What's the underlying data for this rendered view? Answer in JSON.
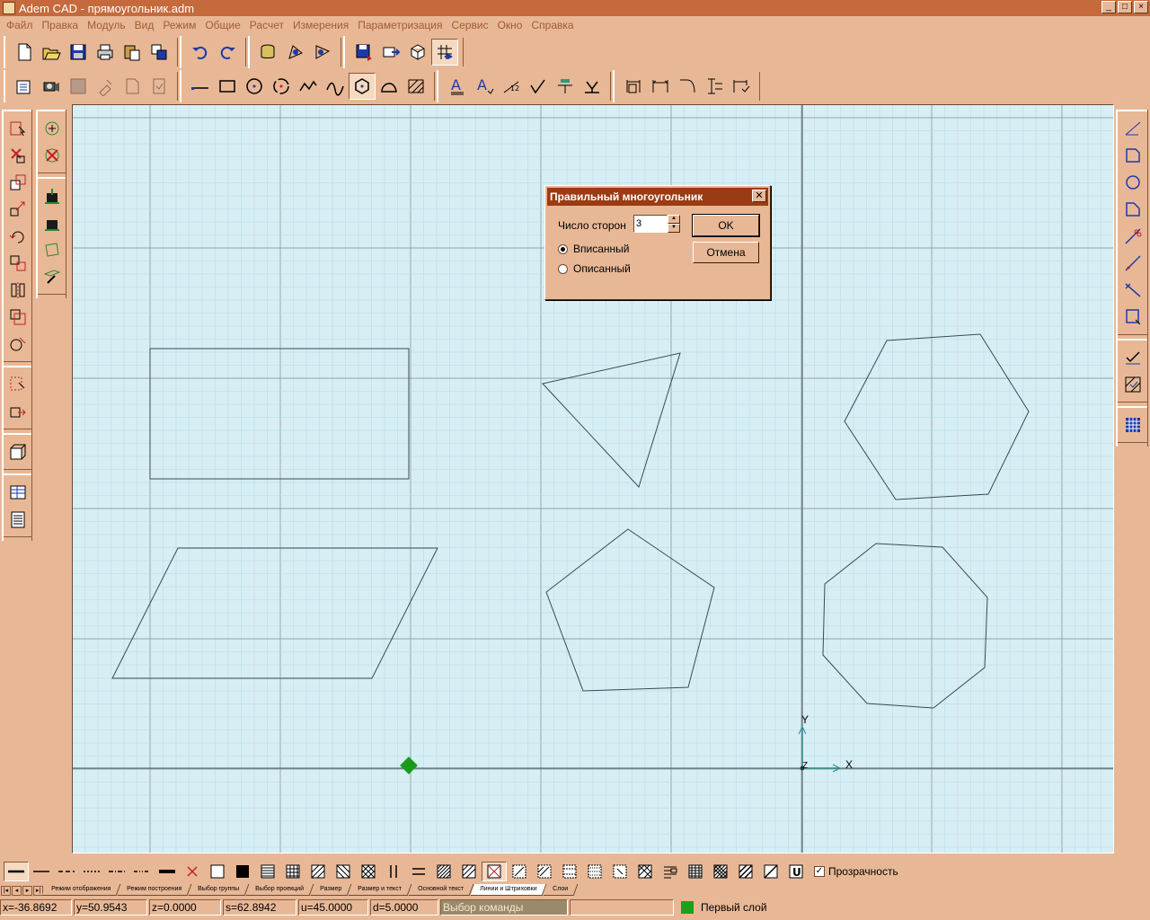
{
  "window": {
    "title": "Adem CAD - прямоугольник.adm",
    "min": "_",
    "max": "□",
    "close": "×"
  },
  "menu": [
    "Файл",
    "Правка",
    "Модуль",
    "Вид",
    "Режим",
    "Общие",
    "Расчет",
    "Измерения",
    "Параметризация",
    "Сервис",
    "Окно",
    "Справка"
  ],
  "colors": {
    "accent": "#c56a3c",
    "canvas_bg": "#d7eef5",
    "grid_major": "#7a8c94",
    "grid_minor": "#b6d8e2",
    "shape_stroke": "#3a4a52",
    "axis": "#2a8a8a",
    "marker": "#1a9a1a"
  },
  "toolbar_top": [
    [
      "new-icon",
      "open-icon",
      "save-icon",
      "print-icon",
      "paste-icon",
      "copy-icon"
    ],
    [
      "undo-icon",
      "redo-icon"
    ],
    [
      "database-icon",
      "view-plane-icon",
      "view-plane-2-icon"
    ],
    [
      "save-disk-icon",
      "export-icon",
      "3d-cube-icon",
      "grid-toggle-icon"
    ]
  ],
  "toolbar_draw": [
    [
      "properties-icon",
      "camera-icon",
      "save-grey-icon",
      "settings-grey-icon",
      "doc-grey-icon",
      "doc-check-grey-icon"
    ],
    [
      "line-icon",
      "rectangle-icon",
      "circle-icon",
      "circle-3pt-icon",
      "spline-icon",
      "curve-icon",
      "polygon-icon",
      "arc-shape-icon",
      "hatch-icon"
    ],
    [
      "text-icon",
      "text-style-icon",
      "dimension-icon",
      "check-mark-icon",
      "roughness-icon",
      "tolerance-icon"
    ],
    [
      "dimension-linear-icon",
      "dimension-horizontal-icon",
      "dimension-angle-icon",
      "dimension-vertical-icon",
      "dimension-chain-icon"
    ]
  ],
  "dialog": {
    "title": "Правильный многоугольник",
    "sides_label": "Число сторон",
    "sides_value": "3",
    "inscribed": "Вписанный",
    "circumscribed": "Описанный",
    "selected_mode": "inscribed",
    "ok": "OK",
    "cancel": "Отмена"
  },
  "axes": {
    "x": "X",
    "y": "Y",
    "z": "Z"
  },
  "bottom_toolbar": {
    "transparency_label": "Прозрачность",
    "transparency_checked": true
  },
  "tabs": {
    "nav": [
      "|◂",
      "◂",
      "▸",
      "▸|"
    ],
    "items": [
      "Режим отображения",
      "Режим построения",
      "Выбор группы",
      "Выбор проекций",
      "Размер",
      "Размер и текст",
      "Основной текст",
      "Линии и Штриховки",
      "Слои"
    ],
    "active": "Линии и Штриховки"
  },
  "status": {
    "x": "x=-36.8692",
    "y": "y=50.9543",
    "z": "z=0.0000",
    "s": "s=62.8942",
    "u": "u=45.0000",
    "d": "d=5.0000",
    "command": "Выбор команды",
    "extra": "",
    "layer": "Первый слой"
  }
}
